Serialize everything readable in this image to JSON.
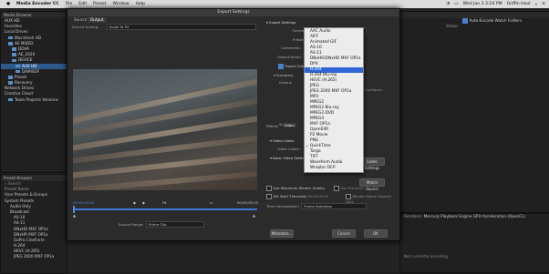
{
  "menubar": {
    "app_name": "Media Encoder CC",
    "items": [
      "File",
      "Edit",
      "Preset",
      "Window",
      "Help"
    ],
    "clock": "Wed Jan 3 3:24 PM",
    "user": "Griffin Haul"
  },
  "media_browser": {
    "title": "Media Browser",
    "location": "AUX HD",
    "rows": [
      "Favorites",
      "Local Drives",
      "Macintosh HD",
      "AE MIXED",
      "DOVA",
      "AE_2020",
      "DEVICE",
      "AUX HD",
      "DAMISOF",
      "Preset",
      "Recovery",
      "Network Drives",
      "Creative Cloud",
      "Team Projects Versions"
    ]
  },
  "preset_browser": {
    "title": "Preset Browser",
    "search_label": "Search",
    "rows": [
      "Preset Name",
      "User Presets & Groups",
      "System Presets",
      "Audio Only",
      "Broadcast",
      "AS-10",
      "AS-11",
      "DNxHD MXF OP1a",
      "DNxHR MXF OP1a",
      "GoPro CineForm",
      "H.264",
      "HEVC (H.265)",
      "JPEG 2000 MXF OP1a"
    ]
  },
  "queue": {
    "auto_encode": "Auto-Encode Watch Folders",
    "status_col": "Status",
    "renderer_label": "Renderer:",
    "renderer_value": "Mercury Playback Engine GPU Acceleration (OpenCL)",
    "not_encoding": "Not currently encoding."
  },
  "dialog": {
    "title": "Export Settings",
    "tabs": [
      "Source",
      "Output"
    ],
    "source_scaling_label": "Source Scaling:",
    "source_scaling_value": "Scale To Fit",
    "export_settings_label": "Export Settings",
    "format_label": "Format:",
    "format_value": "QuickTime",
    "preset_label": "Preset:",
    "comments_label": "Comments:",
    "output_name_label": "Output Name:",
    "export_video_label": "Export Video",
    "summary_label": "Summary",
    "output_label": "Output:",
    "source_label": "Source:",
    "effects_tab": "Effects",
    "video_tab": "Video",
    "video_codec_section": "Video Codec",
    "video_codec_label": "Video Codec:",
    "basic_video_label": "Basic Video Settings",
    "match_source_btn": "Match Source",
    "codec_settings_btn": "Codec Settings",
    "reconfig_text": "Configure...",
    "max_render_quality": "Use Maximum Render Quality",
    "use_previews": "Use Previews",
    "set_start_timecode": "Set Start Timecode",
    "timecode_value": "00;00;00;00",
    "render_alpha": "Render Alpha Channel Only",
    "time_interp_label": "Time Interpolation:",
    "time_interp_value": "Frame Sampling",
    "metadata_btn": "Metadata...",
    "cancel_btn": "Cancel",
    "ok_btn": "OK",
    "timecode_in": "00;00;00;00",
    "timecode_out": "00;00;05;15",
    "fit_label": "Fit",
    "source_range_label": "Source Range:",
    "source_range_value": "Entire Clip"
  },
  "format_dropdown": {
    "options": [
      "AAC Audio",
      "AIFF",
      "Animated GIF",
      "AS-10",
      "AS-11",
      "DNxHR/DNxHD MXF OP1a",
      "DPX",
      "H.264",
      "H.264 Blu-ray",
      "HEVC (H.265)",
      "JPEG",
      "JPEG 2000 MXF OP1a",
      "MP3",
      "MPEG2",
      "MPEG2 Blu-ray",
      "MPEG2-DVD",
      "MPEG4",
      "MXF OP1a",
      "OpenEXR",
      "P2 Movie",
      "PNG",
      "QuickTime",
      "Targa",
      "TIFF",
      "Waveform Audio",
      "Wraptor DCP"
    ],
    "highlighted": "H.264",
    "checked": "QuickTime"
  },
  "colors": {
    "highlight": "#2f65d6",
    "accent_blue": "#4a7fd0",
    "timeline_blue": "#3c78d8"
  }
}
